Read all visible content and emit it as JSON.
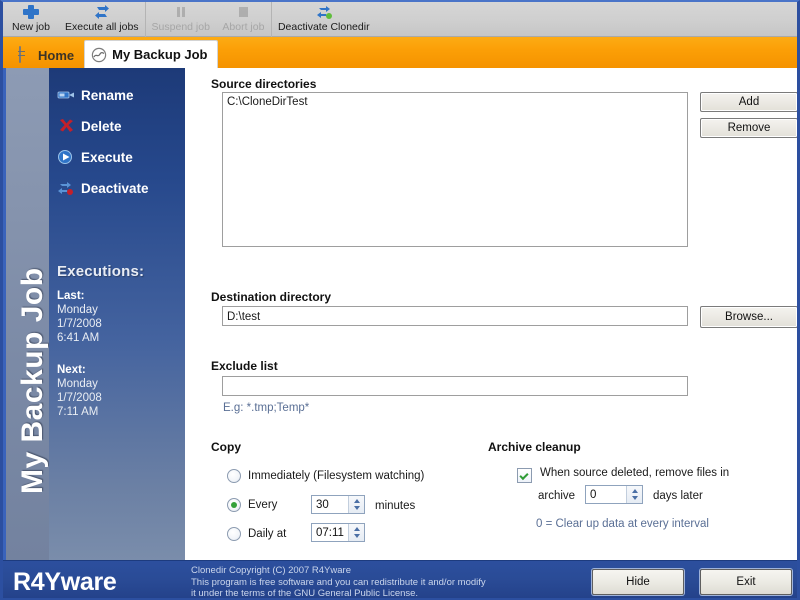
{
  "toolbar": {
    "items": [
      {
        "label": "New job",
        "icon": "plus-icon",
        "disabled": false
      },
      {
        "label": "Execute all jobs",
        "icon": "refresh-icon",
        "disabled": false
      },
      {
        "label": "Suspend job",
        "icon": "pause-icon",
        "disabled": true
      },
      {
        "label": "Abort job",
        "icon": "stop-icon",
        "disabled": true
      },
      {
        "label": "Deactivate Clonedir",
        "icon": "deactivate-icon",
        "disabled": false
      }
    ]
  },
  "tabs": [
    {
      "label": "Home",
      "icon": "server-icon",
      "active": false
    },
    {
      "label": "My Backup Job",
      "icon": "job-icon",
      "active": true
    }
  ],
  "sidebar": {
    "title": "My Backup Job",
    "actions": [
      {
        "label": "Rename",
        "icon": "rename-icon"
      },
      {
        "label": "Delete",
        "icon": "delete-icon"
      },
      {
        "label": "Execute",
        "icon": "execute-icon"
      },
      {
        "label": "Deactivate",
        "icon": "deactivate-icon"
      }
    ],
    "executions_heading": "Executions:",
    "last": {
      "label": "Last:",
      "lines": [
        "Monday",
        "1/7/2008",
        "6:41 AM"
      ]
    },
    "next": {
      "label": "Next:",
      "lines": [
        "Monday",
        "1/7/2008",
        "7:11 AM"
      ]
    }
  },
  "main": {
    "source": {
      "label": "Source directories",
      "entries": [
        "C:\\CloneDirTest"
      ],
      "add_label": "Add",
      "remove_label": "Remove"
    },
    "destination": {
      "label": "Destination directory",
      "value": "D:\\test",
      "browse_label": "Browse..."
    },
    "exclude": {
      "label": "Exclude list",
      "value": "",
      "hint": "E.g: *.tmp;Temp*"
    },
    "copy": {
      "label": "Copy",
      "options": [
        {
          "id": "immediately",
          "label": "Immediately (Filesystem watching)",
          "selected": false
        },
        {
          "id": "every",
          "label": "Every",
          "selected": true,
          "value": "30",
          "suffix": "minutes"
        },
        {
          "id": "daily",
          "label": "Daily at",
          "selected": false,
          "value": "07:11",
          "suffix": ""
        }
      ]
    },
    "archive": {
      "label": "Archive cleanup",
      "checkbox_checked": true,
      "text_line1": "When source deleted, remove files in",
      "text_line2_pre": "archive",
      "days_value": "0",
      "text_line2_post": "days later",
      "note": "0 = Clear up data at every interval"
    }
  },
  "footer": {
    "brand": "R4Yware",
    "copyright_lines": [
      "Clonedir  Copyright (C) 2007  R4Yware",
      "This program is free software and you can redistribute it and/or modify",
      "it under the terms of the GNU General Public License."
    ],
    "hide_label": "Hide",
    "exit_label": "Exit"
  },
  "colors": {
    "accent_orange": "#fb9e06",
    "frame_blue": "#2c4fa0",
    "footer_blue": "#2a4b96",
    "sidebar_blue": "#26488c"
  }
}
